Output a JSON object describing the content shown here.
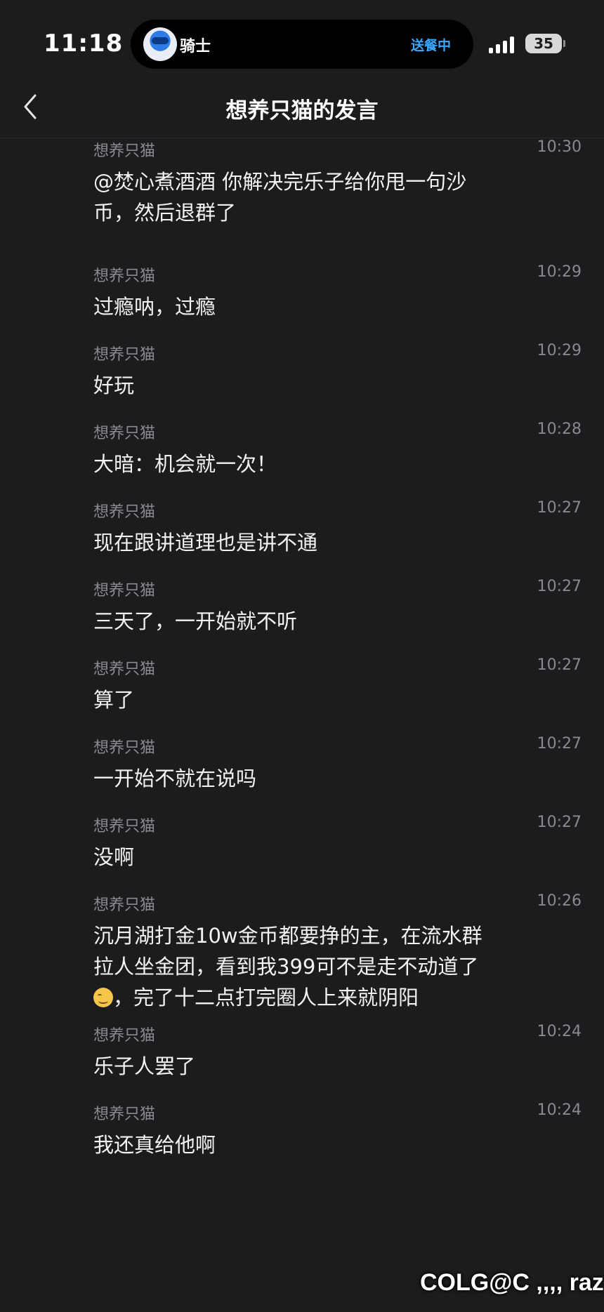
{
  "status_bar": {
    "time": "11:18",
    "island": {
      "name": "骑士",
      "status": "送餐中"
    },
    "battery": "35"
  },
  "nav": {
    "title": "想养只猫的发言"
  },
  "messages": [
    {
      "sender": "想养只猫",
      "time": "10:30",
      "lines": [
        "@焚心煮酒酒 你解决完乐子给你甩一句沙",
        "币，然后退群了"
      ]
    },
    {
      "sender": "想养只猫",
      "time": "10:29",
      "lines": [
        "过瘾呐，过瘾"
      ]
    },
    {
      "sender": "想养只猫",
      "time": "10:29",
      "lines": [
        "好玩"
      ]
    },
    {
      "sender": "想养只猫",
      "time": "10:28",
      "lines": [
        "大暗：机会就一次！"
      ]
    },
    {
      "sender": "想养只猫",
      "time": "10:27",
      "lines": [
        "现在跟讲道理也是讲不通"
      ]
    },
    {
      "sender": "想养只猫",
      "time": "10:27",
      "lines": [
        "三天了，一开始就不听"
      ]
    },
    {
      "sender": "想养只猫",
      "time": "10:27",
      "lines": [
        "算了"
      ]
    },
    {
      "sender": "想养只猫",
      "time": "10:27",
      "lines": [
        "一开始不就在说吗"
      ]
    },
    {
      "sender": "想养只猫",
      "time": "10:27",
      "lines": [
        "没啊"
      ]
    },
    {
      "sender": "想养只猫",
      "time": "10:26",
      "lines": [
        "沉月湖打金10w金币都要挣的主，在流水群",
        "拉人坐金团，看到我399可不是走不动道了",
        "，完了十二点打完圈人上来就阴阳"
      ],
      "emoji_line": 2
    },
    {
      "sender": "想养只猫",
      "time": "10:24",
      "lines": [
        "乐子人罢了"
      ]
    },
    {
      "sender": "想养只猫",
      "time": "10:24",
      "lines": [
        "我还真给他啊"
      ]
    }
  ],
  "watermark": "COLG@C ,,,, razy"
}
